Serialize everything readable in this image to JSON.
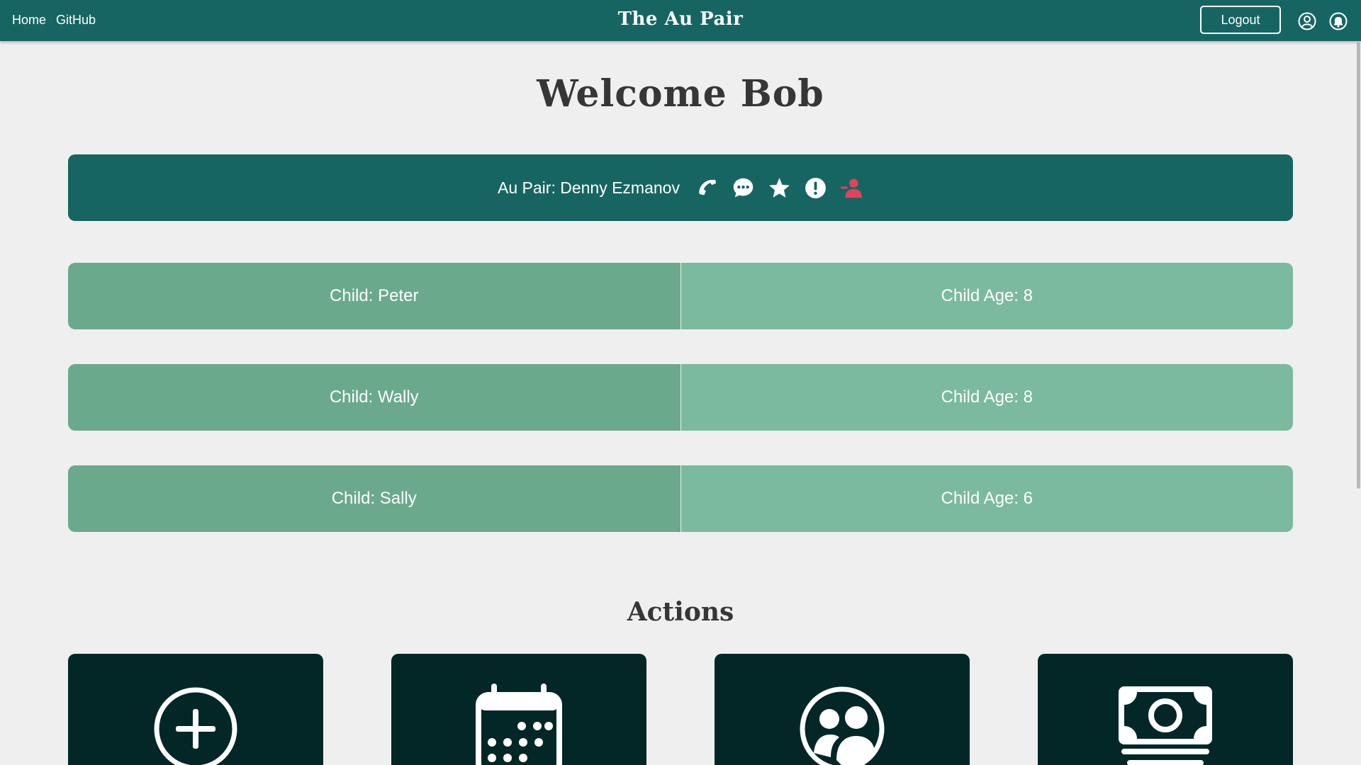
{
  "nav": {
    "links": [
      "Home",
      "GitHub"
    ],
    "brand": "The Au Pair",
    "logout_label": "Logout",
    "icons": [
      "user-circle-icon",
      "bell-icon"
    ]
  },
  "welcome": "Welcome Bob",
  "au_pair": {
    "label": "Au Pair: Denny Ezmanov",
    "icons": [
      "phone-icon",
      "chat-icon",
      "star-icon",
      "alert-icon",
      "remove-user-icon"
    ],
    "remove_color": "#e0435a"
  },
  "children": [
    {
      "name": "Child: Peter",
      "age": "Child Age: 8"
    },
    {
      "name": "Child: Wally",
      "age": "Child Age: 8"
    },
    {
      "name": "Child: Sally",
      "age": "Child Age: 6"
    }
  ],
  "actions": {
    "title": "Actions",
    "cards": [
      "add-circle-icon",
      "calendar-icon",
      "people-icon",
      "money-icon"
    ]
  },
  "colors": {
    "primary": "#176562",
    "child_name_bg": "#6ba98d",
    "child_age_bg": "#7bba9e",
    "action_card_bg": "#022726",
    "background": "#efefef"
  }
}
